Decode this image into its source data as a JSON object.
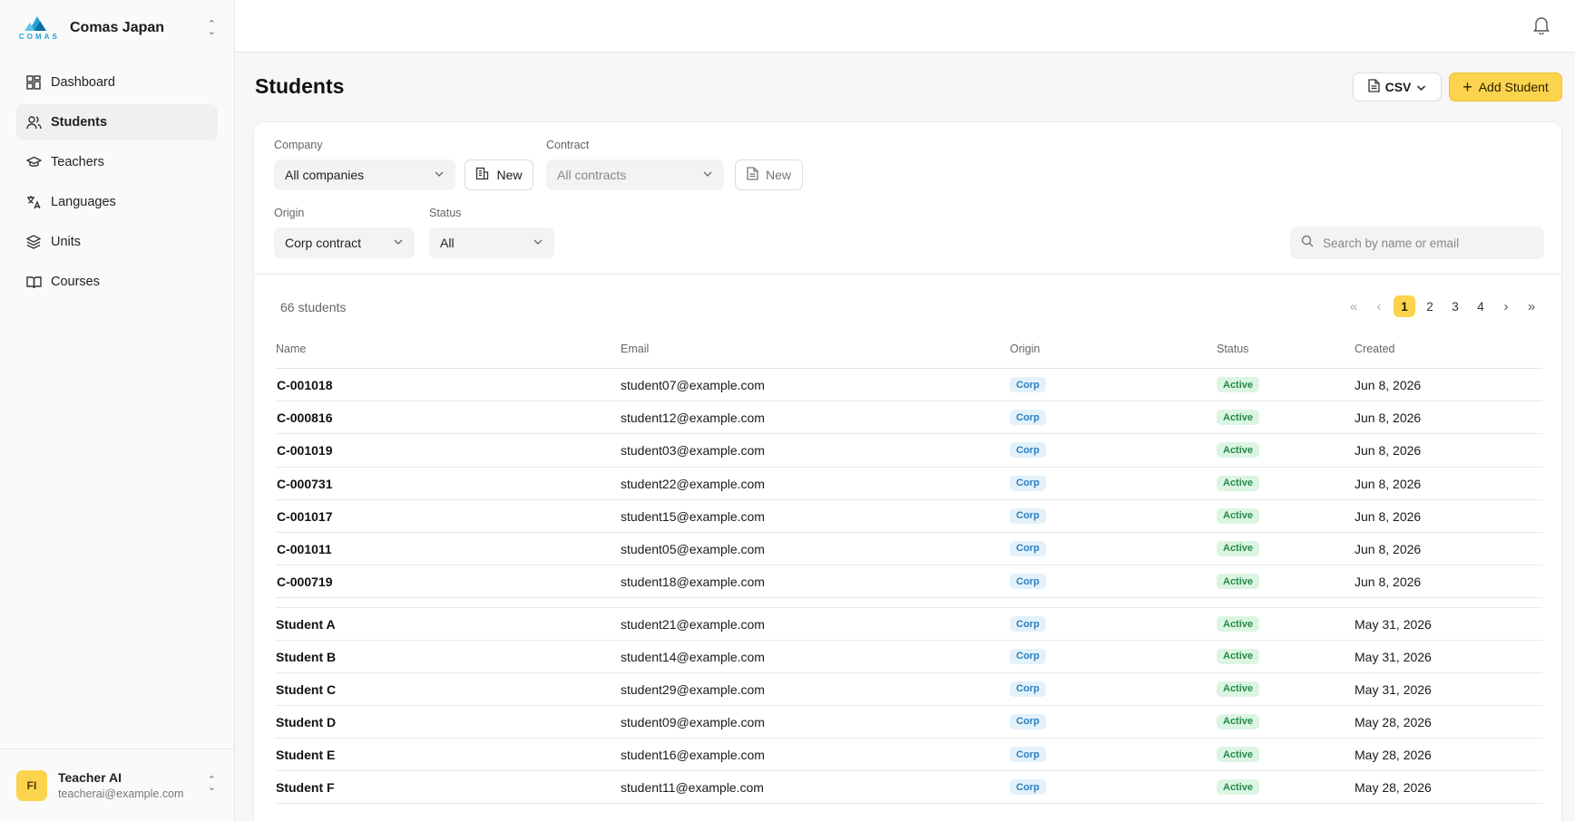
{
  "brand": {
    "logo_text": "COMAS",
    "name": "Comas Japan"
  },
  "nav": [
    {
      "label": "Dashboard",
      "icon": "dashboard-icon"
    },
    {
      "label": "Students",
      "icon": "users-icon",
      "active": true
    },
    {
      "label": "Teachers",
      "icon": "graduation-cap-icon"
    },
    {
      "label": "Languages",
      "icon": "languages-icon"
    },
    {
      "label": "Units",
      "icon": "layers-icon"
    },
    {
      "label": "Courses",
      "icon": "book-open-icon"
    }
  ],
  "user": {
    "initials": "FI",
    "name": "Teacher AI",
    "email": "teacherai@example.com"
  },
  "header": {
    "title": "Students",
    "csv_label": "CSV",
    "add_label": "Add Student"
  },
  "filters": {
    "company_label": "Company",
    "company_value": "All companies",
    "company_new_label": "New",
    "contract_label": "Contract",
    "contract_value": "All contracts",
    "contract_new_label": "New",
    "origin_label": "Origin",
    "origin_value": "Corp contract",
    "status_label": "Status",
    "status_value": "All",
    "search_placeholder": "Search by name or email"
  },
  "summary": {
    "count_text": "66 students"
  },
  "pagination": {
    "pages": [
      "1",
      "2",
      "3",
      "4"
    ],
    "current": "1"
  },
  "table": {
    "columns": [
      "Name",
      "Email",
      "Origin",
      "Status",
      "Created"
    ],
    "rows": [
      {
        "name": "C-001018",
        "email": "student07@example.com",
        "origin": "Corp",
        "status": "Active",
        "created": "Jun 8, 2026"
      },
      {
        "name": "C-000816",
        "email": "student12@example.com",
        "origin": "Corp",
        "status": "Active",
        "created": "Jun 8, 2026"
      },
      {
        "name": "C-001019",
        "email": "student03@example.com",
        "origin": "Corp",
        "status": "Active",
        "created": "Jun 8, 2026"
      },
      {
        "name": "C-000731",
        "email": "student22@example.com",
        "origin": "Corp",
        "status": "Active",
        "created": "Jun 8, 2026"
      },
      {
        "name": "C-001017",
        "email": "student15@example.com",
        "origin": "Corp",
        "status": "Active",
        "created": "Jun 8, 2026"
      },
      {
        "name": "C-001011",
        "email": "student05@example.com",
        "origin": "Corp",
        "status": "Active",
        "created": "Jun 8, 2026"
      },
      {
        "name": "C-000719",
        "email": "student18@example.com",
        "origin": "Corp",
        "status": "Active",
        "created": "Jun 8, 2026"
      },
      {
        "name": "Student A",
        "email": "student21@example.com",
        "origin": "Corp",
        "status": "Active",
        "created": "May 31, 2026"
      },
      {
        "name": "Student B",
        "email": "student14@example.com",
        "origin": "Corp",
        "status": "Active",
        "created": "May 31, 2026"
      },
      {
        "name": "Student C",
        "email": "student29@example.com",
        "origin": "Corp",
        "status": "Active",
        "created": "May 31, 2026"
      },
      {
        "name": "Student D",
        "email": "student09@example.com",
        "origin": "Corp",
        "status": "Active",
        "created": "May 28, 2026"
      },
      {
        "name": "Student E",
        "email": "student16@example.com",
        "origin": "Corp",
        "status": "Active",
        "created": "May 28, 2026"
      },
      {
        "name": "Student F",
        "email": "student11@example.com",
        "origin": "Corp",
        "status": "Active",
        "created": "May 28, 2026"
      }
    ]
  },
  "colors": {
    "accent": "#fcd34d",
    "brand": "#1fa3d6",
    "badge_corp": "#2a7fc0",
    "badge_active": "#228b45"
  }
}
